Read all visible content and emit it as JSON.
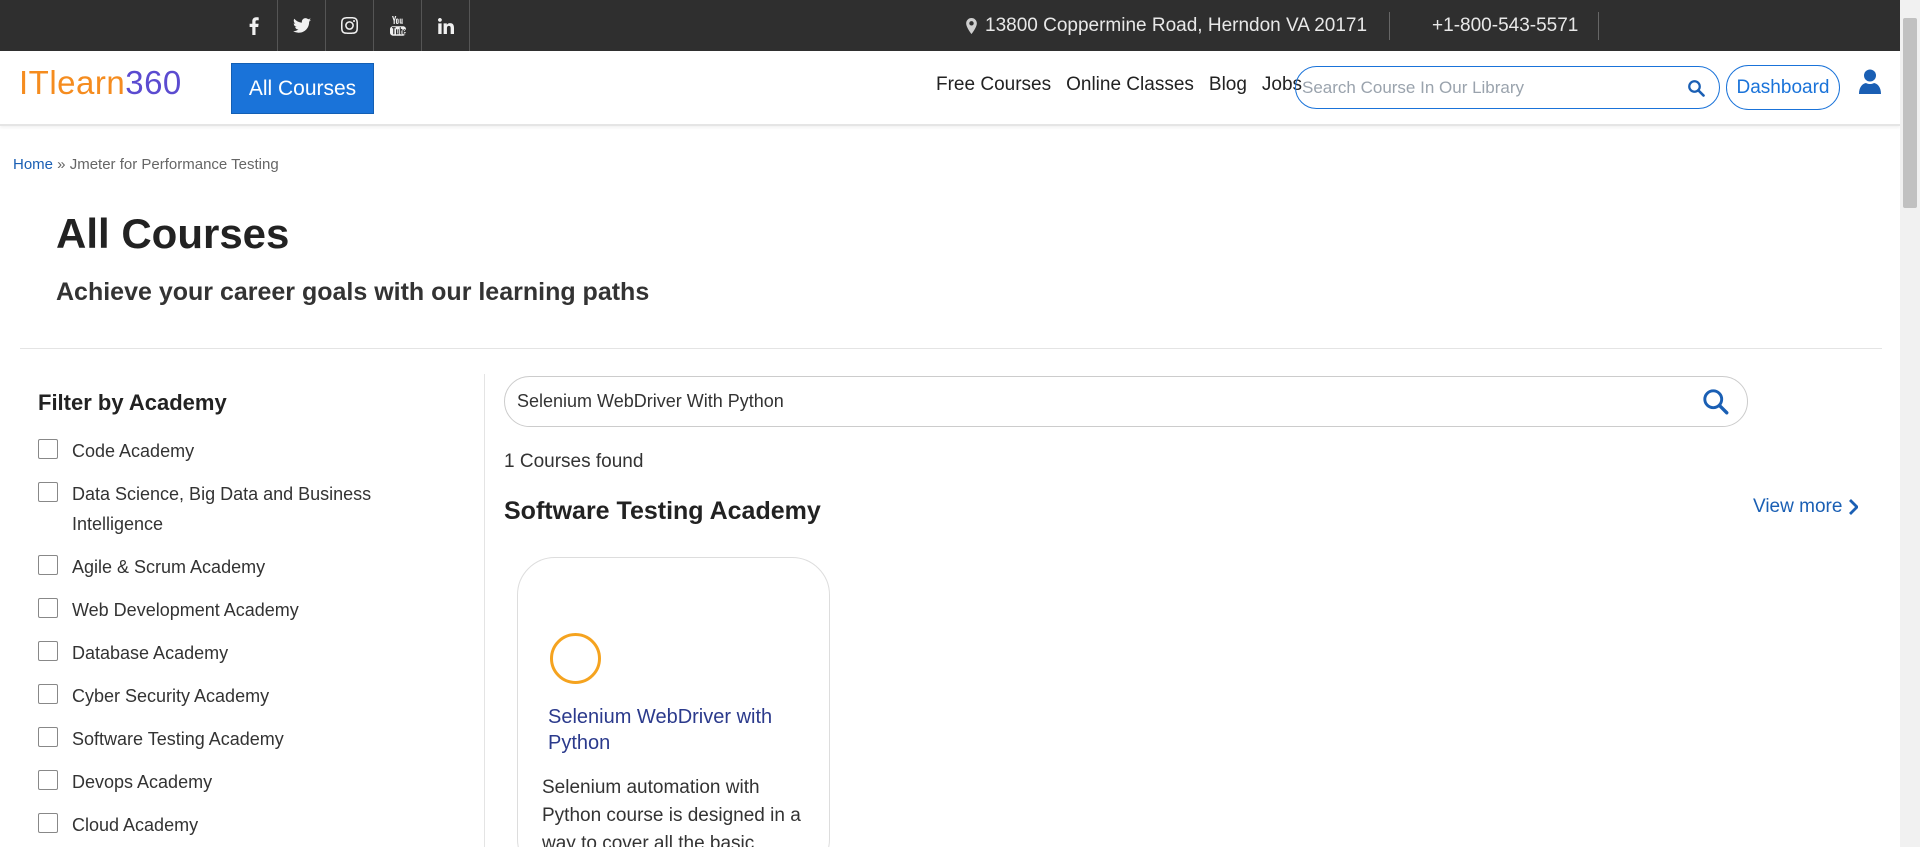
{
  "topbar": {
    "social_icons": [
      "facebook-icon",
      "twitter-icon",
      "instagram-icon",
      "youtube-icon",
      "linkedin-icon"
    ],
    "address": "13800 Coppermine Road, Herndon VA 20171",
    "phone": "+1-800-543-5571"
  },
  "header": {
    "logo_part1": "ITlearn",
    "logo_part2": "360",
    "all_courses_label": "All Courses",
    "nav": [
      "Free Courses",
      "Online Classes",
      "Blog",
      "Jobs"
    ],
    "search_placeholder": "Search Course In Our Library",
    "dashboard_label": "Dashboard"
  },
  "breadcrumb": {
    "home": "Home",
    "separator": " » ",
    "current": "Jmeter for Performance Testing"
  },
  "page": {
    "title": "All Courses",
    "subtitle": "Achieve your career goals with our learning paths"
  },
  "filter": {
    "title": "Filter by Academy",
    "items": [
      "Code Academy",
      "Data Science, Big Data and Business Intelligence",
      "Agile & Scrum Academy",
      "Web Development Academy",
      "Database Academy",
      "Cyber Security Academy",
      "Software Testing Academy",
      "Devops Academy",
      "Cloud Academy"
    ]
  },
  "main": {
    "search_value": "Selenium WebDriver With Python",
    "courses_found": "1 Courses found",
    "academy_title": "Software Testing Academy",
    "view_more": "View more",
    "course": {
      "title": "Selenium WebDriver with Python",
      "description": "Selenium automation with Python course is designed in a way to cover all the basic"
    }
  },
  "colors": {
    "accent": "#1a73d9",
    "logo_orange": "#f58c1f",
    "logo_purple": "#5b4bd0",
    "topbar_bg": "#2f2f2f",
    "course_icon_ring": "#f5a31f"
  }
}
